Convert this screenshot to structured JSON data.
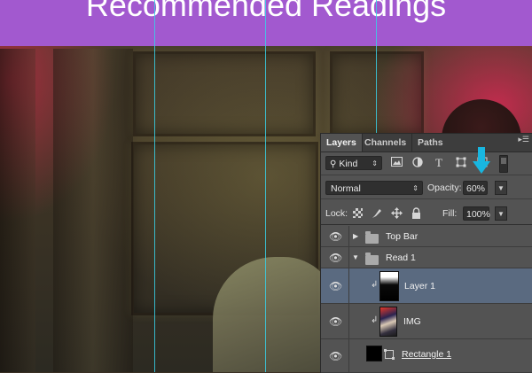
{
  "page": {
    "title": "Recommended Readings"
  },
  "colors": {
    "title_bar": "#a259cf",
    "guide": "#38d0e6",
    "panel_bg": "#535353",
    "selected_layer": "#5a6a80",
    "arrow": "#18b6e0"
  },
  "layers_panel": {
    "tabs": [
      {
        "label": "Layers",
        "active": true
      },
      {
        "label": "Channels",
        "active": false
      },
      {
        "label": "Paths",
        "active": false
      }
    ],
    "filter": {
      "kind_label": "Kind",
      "icons": [
        "image-filter-icon",
        "adjustment-filter-icon",
        "type-filter-icon",
        "shape-filter-icon",
        "smart-object-filter-icon"
      ]
    },
    "blend_mode": "Normal",
    "opacity_label": "Opacity:",
    "opacity_value": "60%",
    "lock_label": "Lock:",
    "lock_icons": [
      "lock-transparent-pixels-icon",
      "lock-image-pixels-icon",
      "lock-position-icon",
      "lock-all-icon"
    ],
    "fill_label": "Fill:",
    "fill_value": "100%",
    "layers": [
      {
        "name": "Top Bar",
        "type": "group",
        "expanded": false,
        "visible": true
      },
      {
        "name": "Read 1",
        "type": "group",
        "expanded": true,
        "visible": true
      },
      {
        "name": "Layer 1",
        "type": "pixel",
        "clipped": true,
        "selected": true,
        "visible": true
      },
      {
        "name": "IMG",
        "type": "image",
        "clipped": true,
        "visible": true
      },
      {
        "name": "Rectangle 1",
        "type": "shape",
        "visible": true
      }
    ]
  }
}
